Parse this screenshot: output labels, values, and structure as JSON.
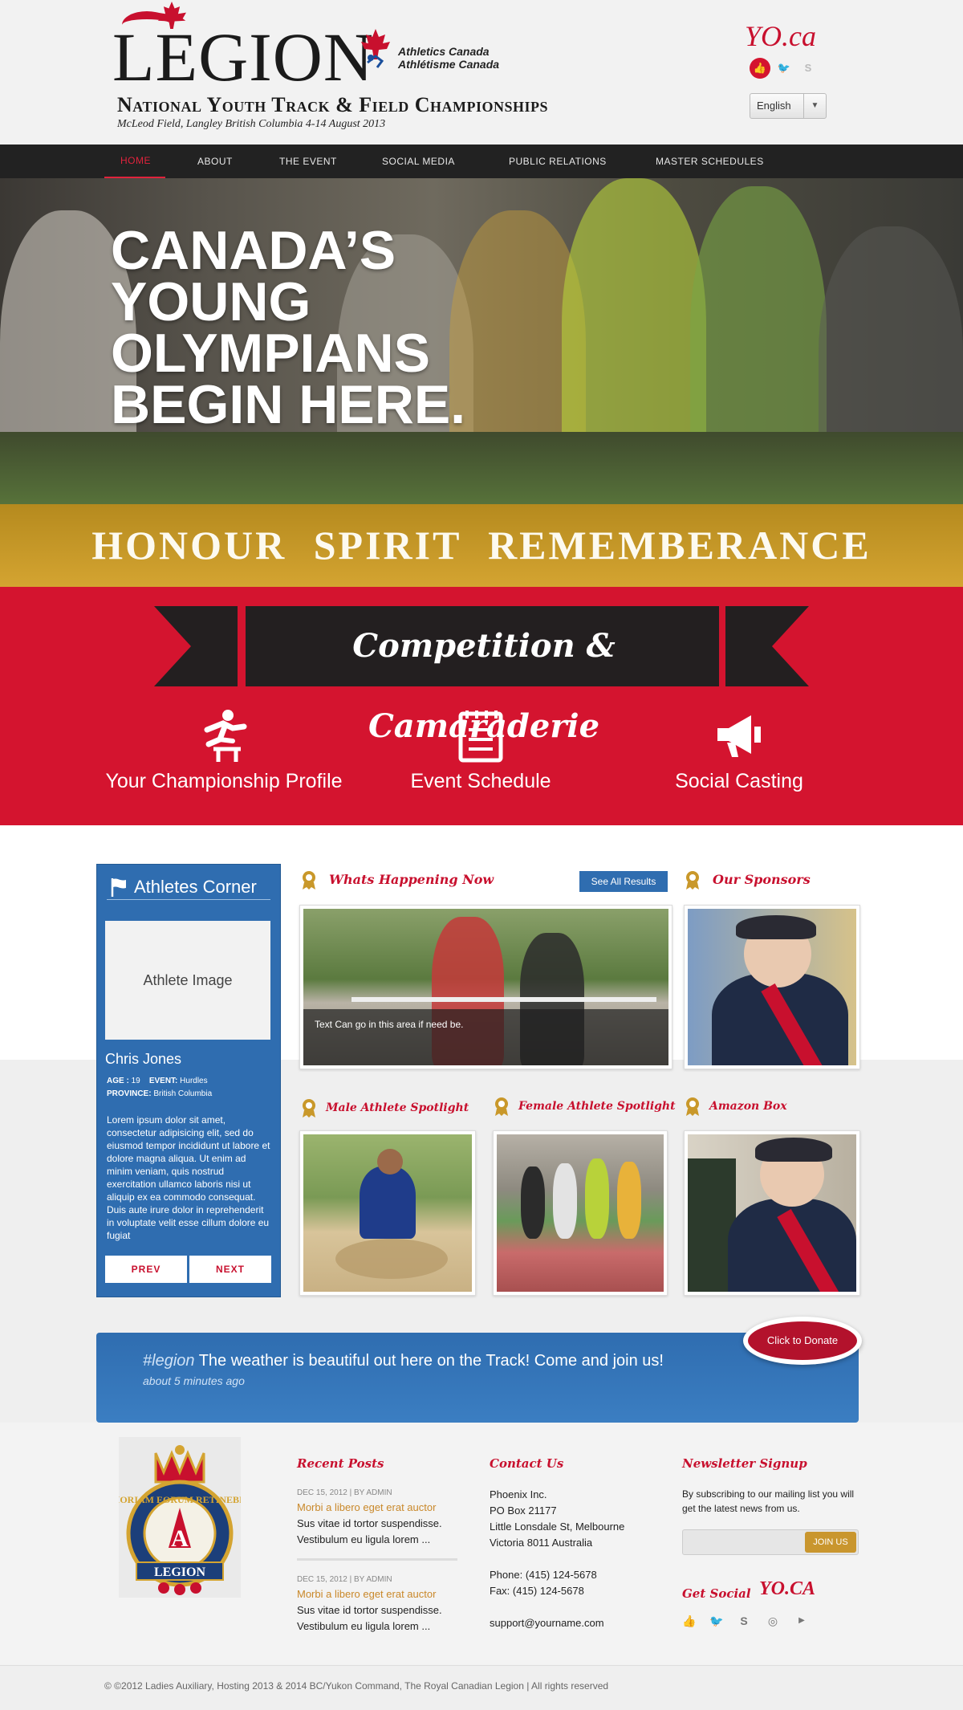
{
  "header": {
    "logo_word": "LEGION",
    "partner_line1": "Athletics Canada",
    "partner_line2": "Athlétisme Canada",
    "title": "National Youth Track & Field Championships",
    "subtitle": "McLeod Field, Langley British Columbia 4-14 August 2013",
    "yo_logo": "YO.ca",
    "social_icons": [
      "thumbs-up-icon",
      "twitter-icon",
      "skype-icon"
    ],
    "language": "English"
  },
  "nav": {
    "items": [
      "HOME",
      "ABOUT",
      "THE EVENT",
      "SOCIAL MEDIA",
      "PUBLIC RELATIONS",
      "MASTER SCHEDULES"
    ],
    "active": "HOME"
  },
  "hero": {
    "line1": "CANADA’S",
    "line2": "YOUNG",
    "line3": "OLYMPIANS",
    "line4": "BEGIN HERE."
  },
  "values_band": {
    "text": "HONOUR  SPIRIT  REMEMBERANCE",
    "color": "#c9982a"
  },
  "banner": {
    "ribbon_text": "Competition & Camaraderie",
    "features": [
      {
        "icon": "hurdler-icon",
        "label": "Your Championship Profile"
      },
      {
        "icon": "schedule-icon",
        "label": "Event Schedule"
      },
      {
        "icon": "megaphone-icon",
        "label": "Social Casting"
      }
    ],
    "color": "#d4142f"
  },
  "athletes_corner": {
    "title": "Athletes Corner",
    "image_placeholder": "Athlete Image",
    "name": "Chris Jones",
    "age_label": "AGE :",
    "age": "19",
    "event_label": "EVENT:",
    "event": "Hurdles",
    "province_label": "PROVINCE:",
    "province": "British Columbia",
    "bio": "Lorem ipsum dolor sit amet, consectetur adipisicing elit, sed do eiusmod tempor incididunt ut labore et dolore magna aliqua. Ut enim ad minim veniam, quis nostrud exercitation ullamco laboris nisi ut aliquip ex ea commodo consequat. Duis aute irure dolor in reprehenderit in voluptate velit esse cillum dolore eu fugiat",
    "prev": "PREV",
    "next": "NEXT",
    "color": "#2f6db0"
  },
  "sections": {
    "whats_happening": "Whats Happening Now",
    "see_all": "See All Results",
    "caption": "Text Can go in this area if need be.",
    "sponsors": "Our Sponsors",
    "male_spotlight": "Male Athlete Spotlight",
    "female_spotlight": "Female Athlete Spotlight",
    "amazon": "Amazon Box"
  },
  "tweet": {
    "hashtag": "#legion",
    "text": "The weather is beautiful out here on the Track! Come and join us!",
    "time": "about 5 minutes ago",
    "donate": "Click to Donate"
  },
  "footer": {
    "recent_posts_title": "Recent Posts",
    "posts": [
      {
        "meta": "DEC 15, 2012  |  BY ADMIN",
        "link": "Morbi a libero eget erat auctor",
        "text1": "Sus vitae id tortor suspendisse.",
        "text2": "Vestibulum eu ligula lorem ..."
      },
      {
        "meta": "DEC 15, 2012  |  BY ADMIN",
        "link": "Morbi a libero eget erat auctor",
        "text1": "Sus vitae id tortor suspendisse.",
        "text2": "Vestibulum eu ligula lorem ..."
      }
    ],
    "contact_title": "Contact Us",
    "contact_lines": [
      "Phoenix Inc.",
      "PO Box 21177",
      "Little Lonsdale St, Melbourne",
      "Victoria 8011 Australia"
    ],
    "phone": "Phone: (415) 124-5678",
    "fax": "Fax: (415) 124-5678",
    "email": "support@yourname.com",
    "newsletter_title": "Newsletter Signup",
    "newsletter_text": "By subscribing to our mailing list you will get the latest news from us.",
    "join": "JOIN US",
    "get_social": "Get Social",
    "yo_small": "YO.CA",
    "social_icons": [
      "thumbs-up-icon",
      "twitter-icon",
      "skype-icon",
      "dribbble-icon",
      "youtube-icon"
    ],
    "crest_motto": "MEMORIAM EORUM RETINEBIMUS",
    "crest_word": "LEGION",
    "crest_letter": "A"
  },
  "copyright": "© ©2012 Ladies Auxiliary, Hosting 2013 & 2014 BC/Yukon Command, The Royal Canadian Legion | All rights reserved"
}
